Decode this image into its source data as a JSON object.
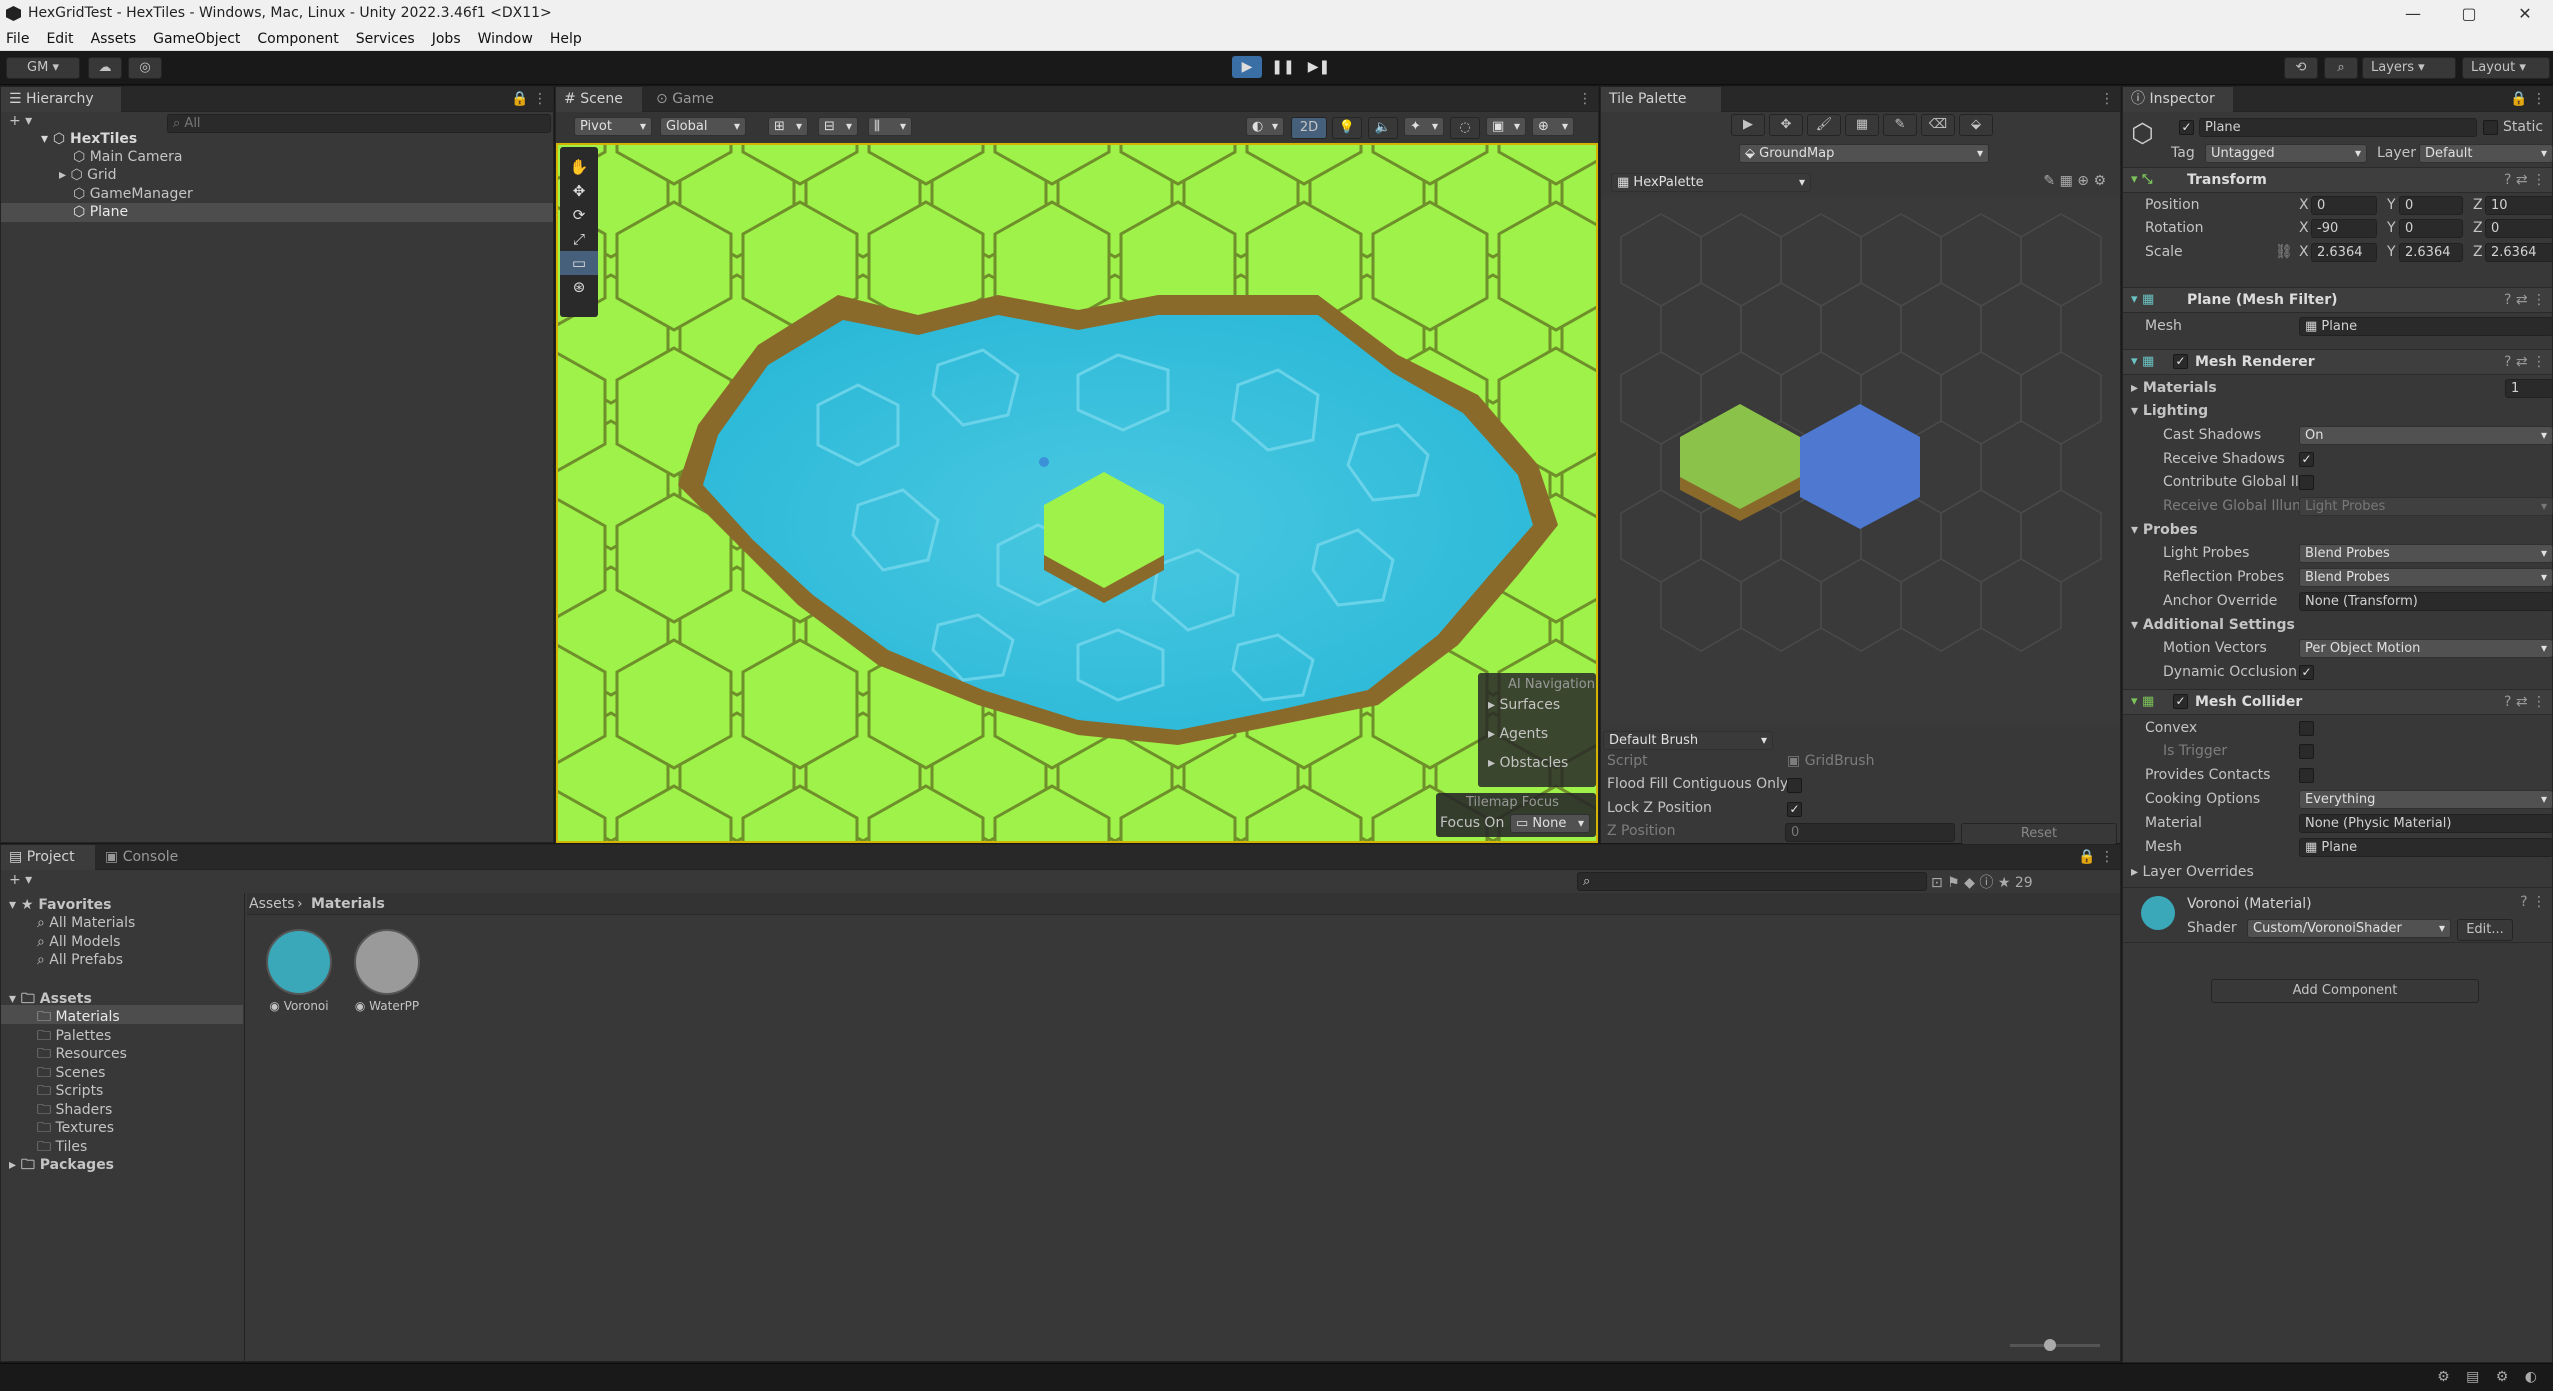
{
  "window": {
    "title": "HexGridTest - HexTiles - Windows, Mac, Linux - Unity 2022.3.46f1 <DX11>",
    "minimize": "—",
    "maximize": "▢",
    "close": "✕"
  },
  "menu": [
    "File",
    "Edit",
    "Assets",
    "GameObject",
    "Component",
    "Services",
    "Jobs",
    "Window",
    "Help"
  ],
  "toolbar": {
    "account": "GM",
    "layers": "Layers",
    "layout": "Layout"
  },
  "hierarchy": {
    "tab": "Hierarchy",
    "search_placeholder": "All",
    "scene": "HexTiles",
    "items": [
      "Main Camera",
      "Grid",
      "GameManager",
      "Plane"
    ]
  },
  "scene_view": {
    "tabs": [
      "Scene",
      "Game"
    ],
    "pivot": "Pivot",
    "global": "Global",
    "mode_2d": "2D",
    "ai_nav": {
      "title": "AI Navigation",
      "items": [
        "Surfaces",
        "Agents",
        "Obstacles"
      ]
    },
    "tilemap_focus": {
      "title": "Tilemap Focus",
      "focus_on": "Focus On",
      "value": "None"
    }
  },
  "tile_palette": {
    "tab": "Tile Palette",
    "target": "GroundMap",
    "palette": "HexPalette",
    "brush": "Default Brush",
    "script_label": "Script",
    "script_value": "GridBrush",
    "flood_fill": "Flood Fill Contiguous Only",
    "lock_z": "Lock Z Position",
    "z_position": "Z Position",
    "z_value": "0",
    "reset": "Reset",
    "tile_colors": {
      "grass": "#8bc34a",
      "blue": "#4f78d1"
    }
  },
  "inspector": {
    "tab": "Inspector",
    "object_name": "Plane",
    "static": "Static",
    "tag_label": "Tag",
    "tag": "Untagged",
    "layer_label": "Layer",
    "layer": "Default",
    "transform": {
      "title": "Transform",
      "position": {
        "label": "Position",
        "x": "0",
        "y": "0",
        "z": "10"
      },
      "rotation": {
        "label": "Rotation",
        "x": "-90",
        "y": "0",
        "z": "0"
      },
      "scale": {
        "label": "Scale",
        "x": "2.6364",
        "y": "2.6364",
        "z": "2.6364"
      }
    },
    "mesh_filter": {
      "title": "Plane (Mesh Filter)",
      "mesh_label": "Mesh",
      "mesh": "Plane"
    },
    "mesh_renderer": {
      "title": "Mesh Renderer",
      "materials": "Materials",
      "materials_count": "1",
      "lighting": "Lighting",
      "cast_shadows": "Cast Shadows",
      "cast_shadows_val": "On",
      "receive_shadows": "Receive Shadows",
      "contribute_gi": "Contribute Global Illu",
      "receive_gi": "Receive Global Illumi",
      "receive_gi_val": "Light Probes",
      "probes": "Probes",
      "light_probes": "Light Probes",
      "light_probes_val": "Blend Probes",
      "reflection_probes": "Reflection Probes",
      "reflection_probes_val": "Blend Probes",
      "anchor_override": "Anchor Override",
      "anchor_override_val": "None (Transform)",
      "additional": "Additional Settings",
      "motion_vectors": "Motion Vectors",
      "motion_vectors_val": "Per Object Motion",
      "dynamic_occlusion": "Dynamic Occlusion"
    },
    "mesh_collider": {
      "title": "Mesh Collider",
      "convex": "Convex",
      "is_trigger": "Is Trigger",
      "provides_contacts": "Provides Contacts",
      "cooking_options": "Cooking Options",
      "cooking_val": "Everything",
      "material": "Material",
      "material_val": "None (Physic Material)",
      "mesh": "Mesh",
      "mesh_val": "Plane"
    },
    "layer_overrides": "Layer Overrides",
    "material": {
      "name": "Voronoi (Material)",
      "shader_label": "Shader",
      "shader": "Custom/VoronoiShader",
      "edit": "Edit..."
    },
    "add_component": "Add Component"
  },
  "project": {
    "tabs": [
      "Project",
      "Console"
    ],
    "favorites": "Favorites",
    "fav_items": [
      "All Materials",
      "All Models",
      "All Prefabs"
    ],
    "assets": "Assets",
    "asset_folders": [
      "Materials",
      "Palettes",
      "Resources",
      "Scenes",
      "Scripts",
      "Shaders",
      "Textures",
      "Tiles"
    ],
    "packages": "Packages",
    "breadcrumb": [
      "Assets",
      "Materials"
    ],
    "files": [
      {
        "name": "Voronoi",
        "color": "#3aa8b8"
      },
      {
        "name": "WaterPP",
        "color": "#9a9a9a"
      }
    ],
    "hidden_count": "29"
  }
}
